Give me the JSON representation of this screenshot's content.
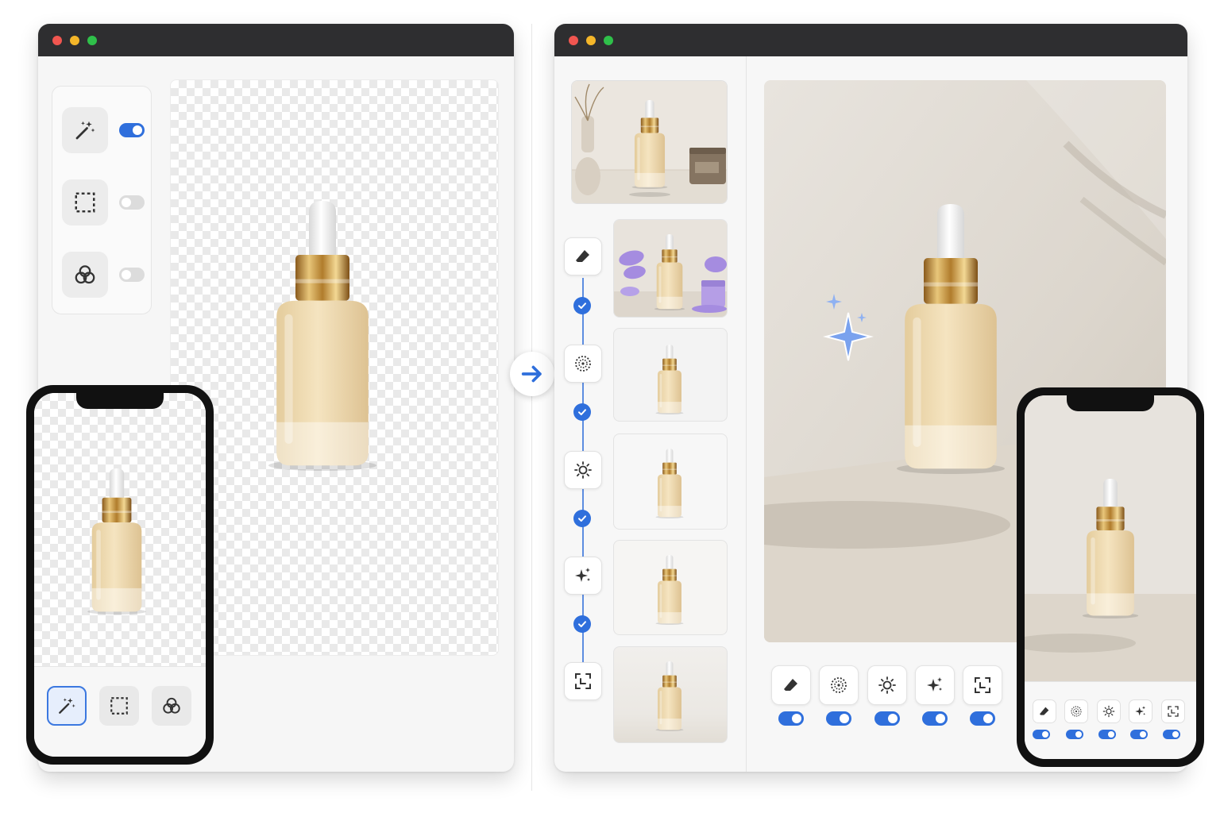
{
  "colors": {
    "accent": "#2f6fdc",
    "window_titlebar": "#2e2e30",
    "traffic_red": "#f15650",
    "traffic_yellow": "#f4b629",
    "traffic_green": "#2fc04a",
    "sparkle": "#6f95e8"
  },
  "left_window": {
    "tools": [
      {
        "icon": "magic-wand-icon",
        "enabled": true
      },
      {
        "icon": "selection-icon",
        "enabled": false
      },
      {
        "icon": "blend-icon",
        "enabled": false
      }
    ],
    "canvas": {
      "background": "transparent-checker",
      "subject": "serum-dropper-bottle"
    }
  },
  "left_phone": {
    "tools": [
      {
        "icon": "magic-wand-icon",
        "active": true
      },
      {
        "icon": "selection-icon",
        "active": false
      },
      {
        "icon": "blend-icon",
        "active": false
      }
    ]
  },
  "flow_arrow": {
    "icon": "arrow-right-icon"
  },
  "right_window": {
    "pipeline_steps": [
      {
        "icon": "eraser-icon",
        "completed": true
      },
      {
        "icon": "dotted-circle-icon",
        "completed": true
      },
      {
        "icon": "sun-icon",
        "completed": true
      },
      {
        "icon": "sparkles-icon",
        "completed": true
      },
      {
        "icon": "expand-icon",
        "completed": false
      }
    ],
    "thumbnails": [
      "styled-scene",
      "purple-props-scene",
      "transparent-cutout",
      "white-background",
      "warm-shadow",
      "neutral-scene"
    ],
    "bottom_tools": [
      {
        "icon": "eraser-icon",
        "enabled": true
      },
      {
        "icon": "dotted-circle-icon",
        "enabled": true
      },
      {
        "icon": "sun-icon",
        "enabled": true
      },
      {
        "icon": "sparkles-icon",
        "enabled": true
      },
      {
        "icon": "expand-icon",
        "enabled": true
      }
    ]
  },
  "right_phone": {
    "tools": [
      {
        "icon": "eraser-icon",
        "enabled": true
      },
      {
        "icon": "dotted-circle-icon",
        "enabled": true
      },
      {
        "icon": "sun-icon",
        "enabled": true
      },
      {
        "icon": "sparkles-icon",
        "enabled": true
      },
      {
        "icon": "expand-icon",
        "enabled": true
      }
    ]
  }
}
